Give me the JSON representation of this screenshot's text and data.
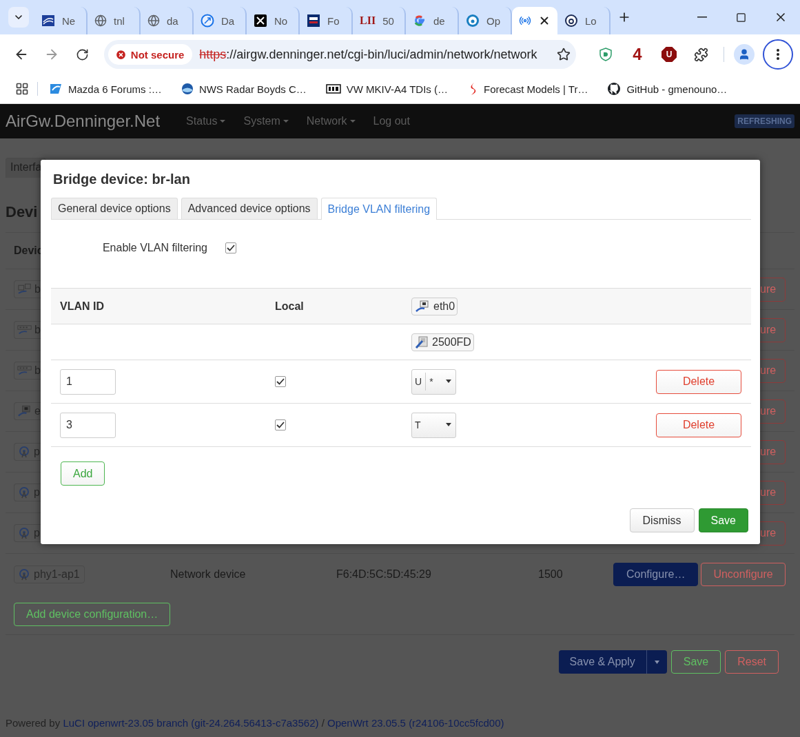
{
  "browser": {
    "tabs": [
      {
        "title": "Ne",
        "selected": false
      },
      {
        "title": "tnl",
        "selected": false
      },
      {
        "title": "da",
        "selected": false
      },
      {
        "title": "Da",
        "selected": false
      },
      {
        "title": "No",
        "selected": false
      },
      {
        "title": "Fo",
        "selected": false
      },
      {
        "favicon_text": "LII",
        "title": "50",
        "selected": false
      },
      {
        "title": "de",
        "selected": false
      },
      {
        "title": "Op",
        "selected": false
      },
      {
        "selected": true
      },
      {
        "title": "Lo",
        "selected": false
      }
    ],
    "security": "Not secure",
    "url_scheme": "https",
    "url_rest": "://airgw.denninger.net/cgi-bin/luci/admin/network/network",
    "extension_badge": "4",
    "extension_letter": "U",
    "bookmarks": [
      "Mazda 6 Forums :…",
      "NWS Radar Boyds C…",
      "VW MKIV-A4 TDIs (…",
      "Forecast Models | Tr…",
      "GitHub - gmenouno…"
    ]
  },
  "header": {
    "brand": "AirGw.Denninger.Net",
    "menus": [
      {
        "label": "Status",
        "dropdown": true
      },
      {
        "label": "System",
        "dropdown": true
      },
      {
        "label": "Network",
        "dropdown": true
      },
      {
        "label": "Log out",
        "dropdown": false
      }
    ],
    "badge": "REFRESHING"
  },
  "page": {
    "tabs": [
      {
        "label": "Interfa",
        "selected": false
      }
    ],
    "heading": "Devi",
    "column_1": "Devic",
    "rows": [
      {
        "kind": "bridge",
        "name": "b",
        "button": "ure"
      },
      {
        "kind": "switch",
        "name": "b",
        "button": "ure"
      },
      {
        "kind": "switch",
        "name": "b",
        "button": "ure"
      },
      {
        "kind": "ethernet",
        "name": "e",
        "button": "ure"
      },
      {
        "kind": "wireless",
        "name": "p",
        "button": "ure"
      },
      {
        "kind": "wireless",
        "name": "p",
        "button": "ure"
      },
      {
        "kind": "wireless",
        "name": "p",
        "button": "ure"
      }
    ],
    "last_row": {
      "kind": "wireless",
      "name": "phy1-ap1",
      "type": "Network device",
      "mac": "F6:4D:5C:5D:45:29",
      "mtu": "1500",
      "configure": "Configure…",
      "unconfigure": "Unconfigure"
    },
    "add_button": "Add device configuration…",
    "actions": {
      "save_apply": "Save & Apply",
      "save": "Save",
      "reset": "Reset"
    },
    "footer": {
      "prefix": "Powered by",
      "luci": "LuCI openwrt-23.05 branch (git-24.264.56413-c7a3562)",
      "separator": "/",
      "openwrt": "OpenWrt 23.05.5 (r24106-10cc5fcd00)"
    }
  },
  "modal": {
    "title": "Bridge device: br-lan",
    "tabs": [
      {
        "label": "General device options",
        "selected": false
      },
      {
        "label": "Advanced device options",
        "selected": false
      },
      {
        "label": "Bridge VLAN filtering",
        "selected": true
      }
    ],
    "enable_label": "Enable VLAN filtering",
    "enable_checked": true,
    "columns": [
      "VLAN ID",
      "Local"
    ],
    "port": {
      "name": "eth0",
      "speed": "2500FD"
    },
    "vlans": [
      {
        "id": "1",
        "local": true,
        "tagging": "U",
        "pvid": "*",
        "delete": "Delete"
      },
      {
        "id": "3",
        "local": true,
        "tagging": "T",
        "delete": "Delete"
      }
    ],
    "add": "Add",
    "dismiss": "Dismiss",
    "save": "Save"
  }
}
